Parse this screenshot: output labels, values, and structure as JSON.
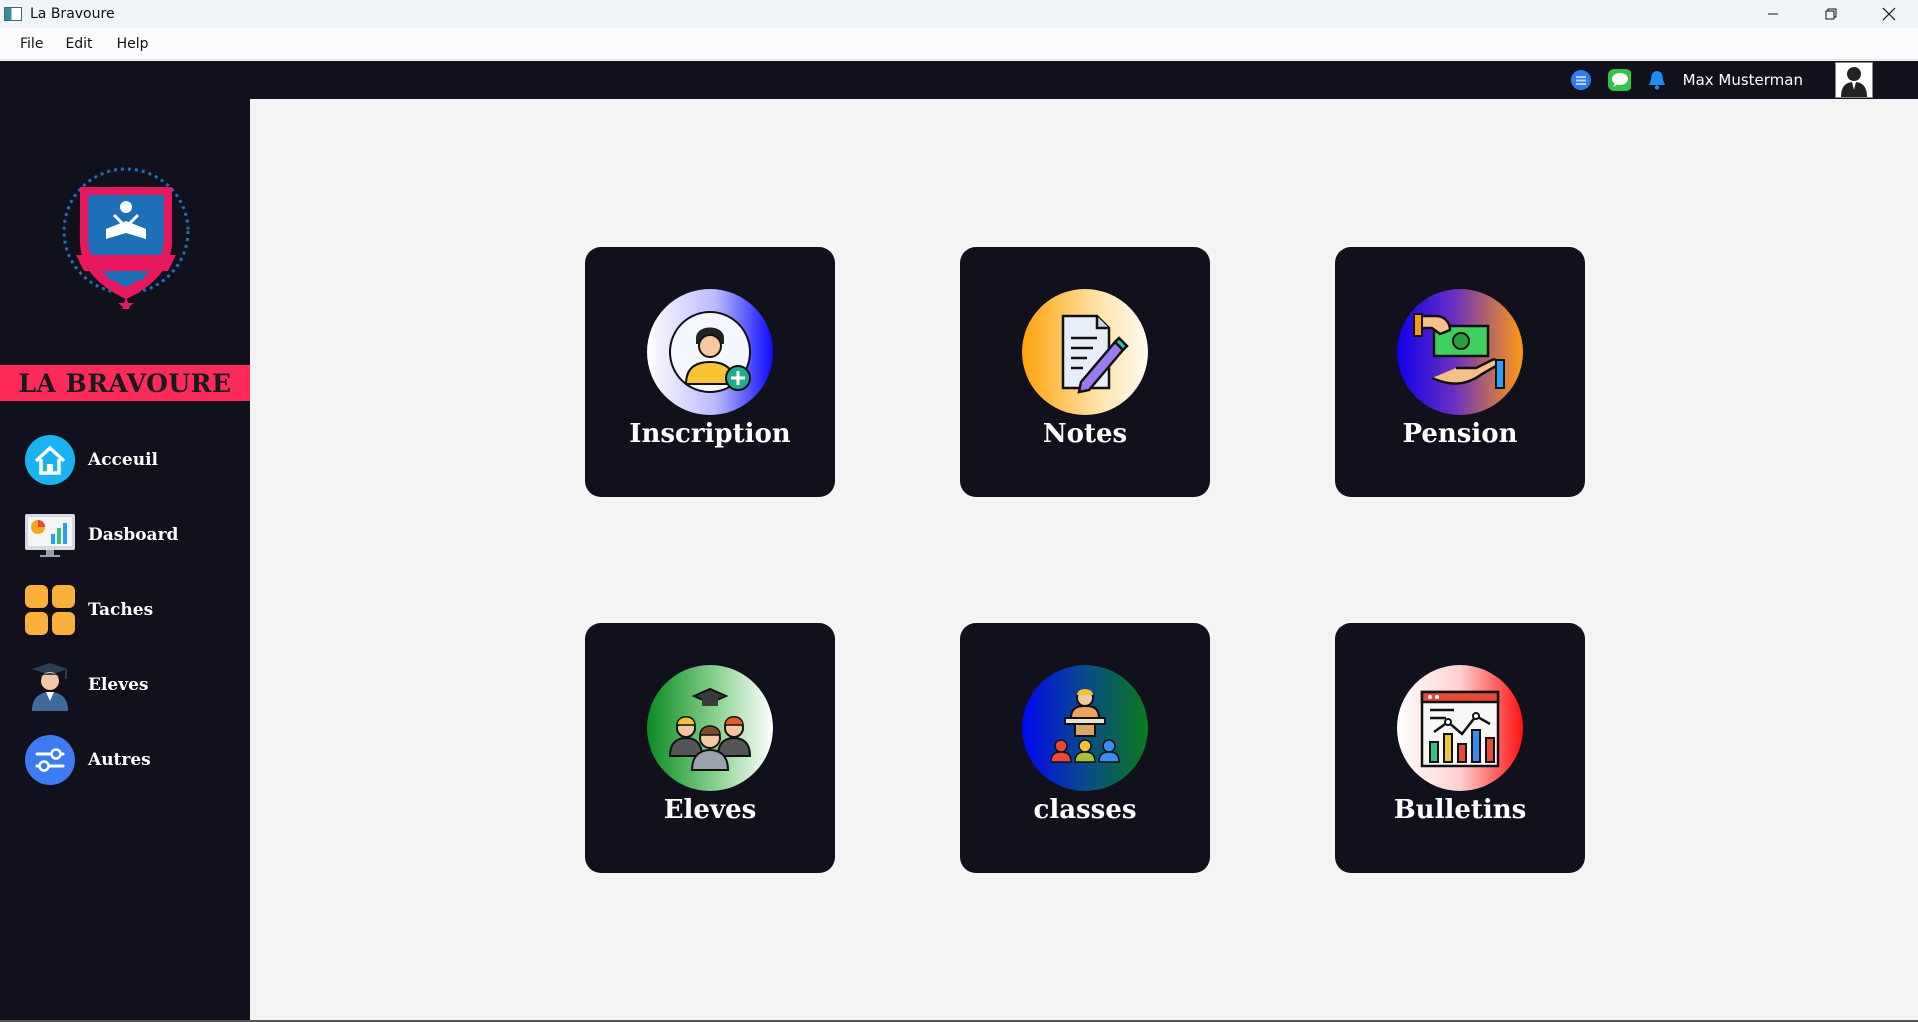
{
  "window": {
    "title": "La Bravoure",
    "controls": [
      "minimize-icon",
      "restore-icon",
      "close-icon"
    ]
  },
  "menu": {
    "items": [
      {
        "label": "File"
      },
      {
        "label": "Edit"
      },
      {
        "label": "Help"
      }
    ]
  },
  "topbar": {
    "icons": [
      "menu-bubble-icon",
      "chat-icon",
      "bell-icon"
    ],
    "user_name": "Max Musterman"
  },
  "sidebar": {
    "brand": "LA BRAVOURE",
    "items": [
      {
        "label": "Acceuil",
        "icon": "home-icon"
      },
      {
        "label": "Dasboard",
        "icon": "dashboard-monitor-icon"
      },
      {
        "label": "Taches",
        "icon": "tasks-grid-icon"
      },
      {
        "label": "Eleves",
        "icon": "graduate-icon"
      },
      {
        "label": "Autres",
        "icon": "settings-sliders-icon"
      }
    ]
  },
  "tiles": [
    {
      "label": "Inscription",
      "icon": "student-add-icon"
    },
    {
      "label": "Notes",
      "icon": "document-pencil-icon"
    },
    {
      "label": "Pension",
      "icon": "money-hand-icon"
    },
    {
      "label": "Eleves",
      "icon": "students-group-icon"
    },
    {
      "label": "classes",
      "icon": "teacher-class-icon"
    },
    {
      "label": "Bulletins",
      "icon": "report-chart-icon"
    }
  ],
  "colors": {
    "dark": "#11101d",
    "brand_pink": "#fe2b5a",
    "content_bg": "#f4f4f4"
  }
}
